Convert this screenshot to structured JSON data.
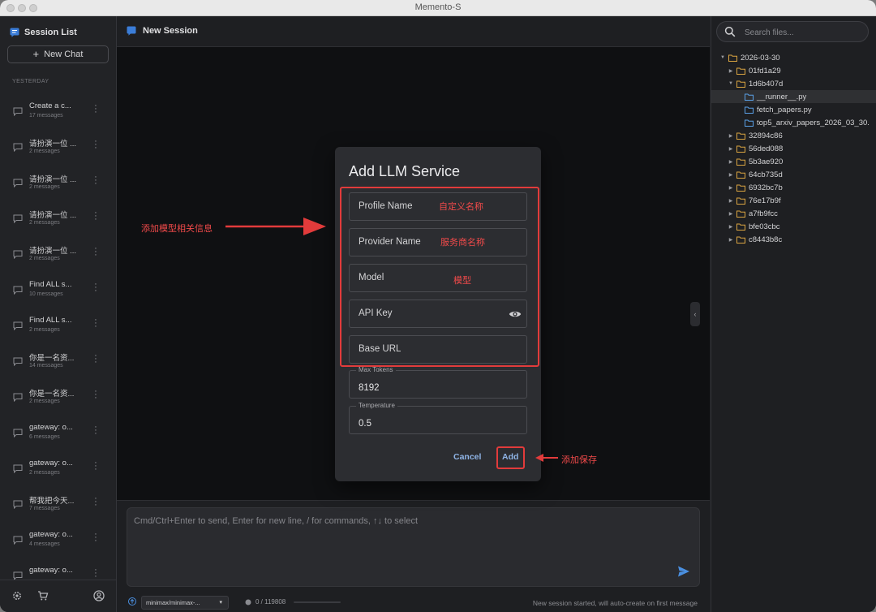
{
  "window": {
    "title": "Memento-S"
  },
  "sidebar": {
    "title": "Session List",
    "new_chat_label": "New Chat",
    "section_label": "YESTERDAY",
    "sessions": [
      {
        "title": "Create a c...",
        "count": "17 messages"
      },
      {
        "title": "请扮演一位 ...",
        "count": "2 messages"
      },
      {
        "title": "请扮演一位 ...",
        "count": "2 messages"
      },
      {
        "title": "请扮演一位 ...",
        "count": "2 messages"
      },
      {
        "title": "请扮演一位 ...",
        "count": "2 messages"
      },
      {
        "title": "Find ALL s...",
        "count": "10 messages"
      },
      {
        "title": "Find ALL s...",
        "count": "2 messages"
      },
      {
        "title": "你是一名资...",
        "count": "14 messages"
      },
      {
        "title": "你是一名资...",
        "count": "2 messages"
      },
      {
        "title": "gateway: o...",
        "count": "6 messages"
      },
      {
        "title": "gateway: o...",
        "count": "2 messages"
      },
      {
        "title": "帮我把今天...",
        "count": "7 messages"
      },
      {
        "title": "gateway: o...",
        "count": "4 messages"
      },
      {
        "title": "gateway: o...",
        "count": ""
      }
    ]
  },
  "main": {
    "title": "New Session",
    "input_placeholder": "Cmd/Ctrl+Enter to send, Enter for new line, / for commands, ↑↓ to select",
    "model_selector": "minimax/minimax-...",
    "token_usage": "0 / 119808",
    "status": "New session started, will auto-create on first message"
  },
  "files": {
    "search_placeholder": "Search files...",
    "tree": [
      {
        "name": "2026-03-30",
        "type": "folder",
        "depth": 0,
        "expanded": true
      },
      {
        "name": "01fd1a29",
        "type": "folder",
        "depth": 1,
        "expanded": false
      },
      {
        "name": "1d6b407d",
        "type": "folder",
        "depth": 1,
        "expanded": true
      },
      {
        "name": "__runner__.py",
        "type": "file",
        "depth": 2,
        "selected": true
      },
      {
        "name": "fetch_papers.py",
        "type": "file",
        "depth": 2
      },
      {
        "name": "top5_arxiv_papers_2026_03_30.",
        "type": "file",
        "depth": 2
      },
      {
        "name": "32894c86",
        "type": "folder",
        "depth": 1,
        "expanded": false
      },
      {
        "name": "56ded088",
        "type": "folder",
        "depth": 1,
        "expanded": false
      },
      {
        "name": "5b3ae920",
        "type": "folder",
        "depth": 1,
        "expanded": false
      },
      {
        "name": "64cb735d",
        "type": "folder",
        "depth": 1,
        "expanded": false
      },
      {
        "name": "6932bc7b",
        "type": "folder",
        "depth": 1,
        "expanded": false
      },
      {
        "name": "76e17b9f",
        "type": "folder",
        "depth": 1,
        "expanded": false
      },
      {
        "name": "a7fb9fcc",
        "type": "folder",
        "depth": 1,
        "expanded": false
      },
      {
        "name": "bfe03cbc",
        "type": "folder",
        "depth": 1,
        "expanded": false
      },
      {
        "name": "c8443b8c",
        "type": "folder",
        "depth": 1,
        "expanded": false
      }
    ]
  },
  "dialog": {
    "title": "Add LLM Service",
    "profile_name_label": "Profile Name",
    "provider_name_label": "Provider Name",
    "model_label": "Model",
    "api_key_label": "API Key",
    "base_url_label": "Base URL",
    "max_tokens_label": "Max Tokens",
    "max_tokens_value": "8192",
    "temperature_label": "Temperature",
    "temperature_value": "0.5",
    "cancel_label": "Cancel",
    "add_label": "Add"
  },
  "annotations": {
    "left_note": "添加模型相关信息",
    "profile_hint": "自定义名称",
    "provider_hint": "服务商名称",
    "model_hint": "模型",
    "save_note": "添加保存"
  },
  "colors": {
    "accent_blue": "#8fb4e6",
    "annotation_red": "#e23b3b",
    "folder_outline": "#d9a441",
    "file_outline": "#5aa0e6"
  }
}
